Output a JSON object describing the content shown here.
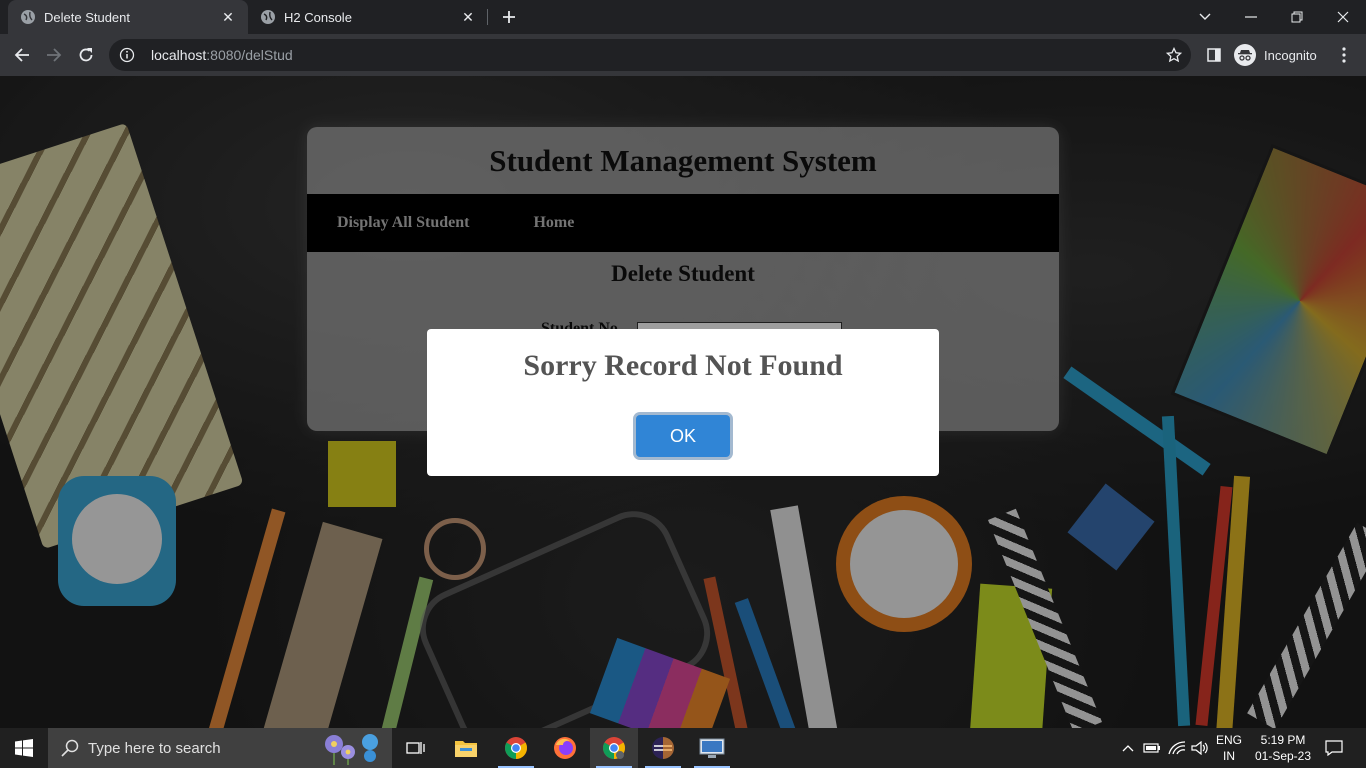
{
  "browser": {
    "tabs": [
      {
        "title": "Delete Student",
        "active": true
      },
      {
        "title": "H2 Console",
        "active": false
      }
    ],
    "url_host": "localhost",
    "url_path": ":8080/delStud",
    "profile_label": "Incognito"
  },
  "app": {
    "title": "Student Management System",
    "nav": {
      "display_all": "Display All Student",
      "home": "Home"
    },
    "section_title": "Delete Student",
    "field_label": "Student No",
    "field_value": ""
  },
  "dialog": {
    "message": "Sorry Record Not Found",
    "ok_label": "OK",
    "ok_color": "#3085d6"
  },
  "taskbar": {
    "search_placeholder": "Type here to search",
    "apps": [
      "task-view",
      "file-explorer",
      "chrome",
      "firefox",
      "chrome-active",
      "eclipse",
      "remote-desktop"
    ],
    "language": {
      "line1": "ENG",
      "line2": "IN"
    },
    "time": "5:19 PM",
    "date": "01-Sep-23"
  }
}
